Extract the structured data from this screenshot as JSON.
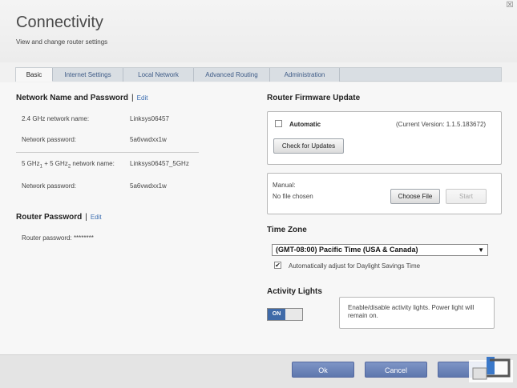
{
  "header": {
    "title": "Connectivity",
    "subtitle": "View and change router settings",
    "close_glyph": "☒"
  },
  "tabs": [
    {
      "label": "Basic",
      "active": true
    },
    {
      "label": "Internet Settings",
      "active": false
    },
    {
      "label": "Local Network",
      "active": false
    },
    {
      "label": "Advanced Routing",
      "active": false
    },
    {
      "label": "Administration",
      "active": false
    }
  ],
  "network": {
    "title": "Network Name and Password",
    "separator": "|",
    "edit": "Edit",
    "rows": [
      {
        "label": "2.4 GHz network name:",
        "value": "Linksys06457"
      },
      {
        "label": "Network password:",
        "value": "5a6vwdxx1w"
      },
      {
        "label": "5 GHz",
        "sub1": "1",
        "plus": " + 5 GHz",
        "sub2": "2",
        "suffix": " network name:",
        "value": "Linksys06457_5GHz"
      },
      {
        "label": "Network password:",
        "value": "5a6vwdxx1w"
      }
    ]
  },
  "router_password": {
    "title": "Router Password",
    "separator": "|",
    "edit": "Edit",
    "label": "Router password:",
    "value": "********"
  },
  "firmware": {
    "title": "Router Firmware Update",
    "automatic_label": "Automatic",
    "automatic_checked": false,
    "current_version": "(Current Version: 1.1.5.183672)",
    "check_button": "Check for Updates",
    "manual_label": "Manual:",
    "file_status": "No file chosen",
    "choose_button": "Choose File",
    "start_button": "Start"
  },
  "timezone": {
    "title": "Time Zone",
    "selected": "(GMT-08:00) Pacific Time (USA & Canada)",
    "arrow": "▼",
    "dst_label": "Automatically adjust for Daylight Savings Time",
    "dst_checked": true,
    "check_glyph": "✔"
  },
  "activity_lights": {
    "title": "Activity Lights",
    "toggle_label": "ON",
    "description": "Enable/disable activity lights. Power light will remain on."
  },
  "footer": {
    "ok": "Ok",
    "cancel": "Cancel"
  },
  "colors": {
    "accent": "#5e77ad",
    "link": "#3b6db0",
    "tab_text": "#3d5a86"
  }
}
